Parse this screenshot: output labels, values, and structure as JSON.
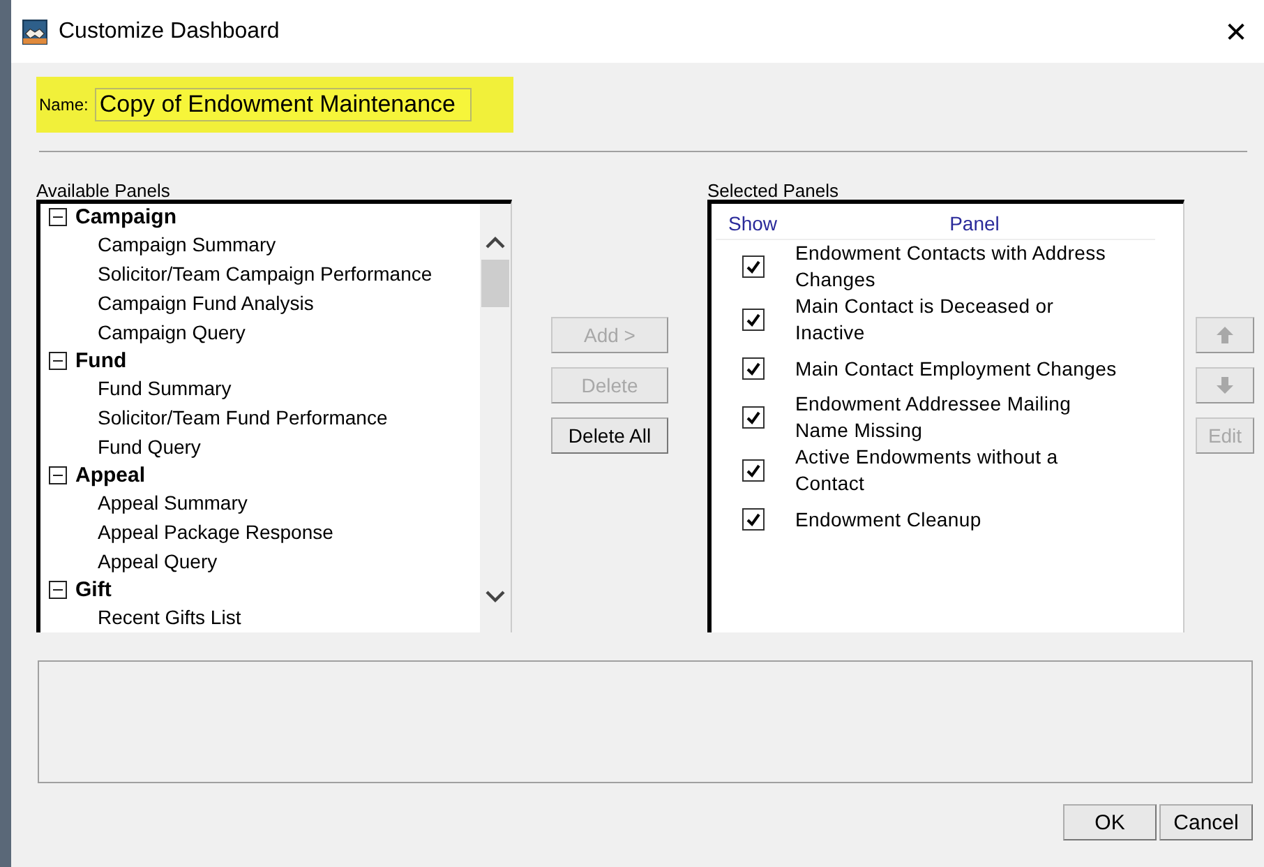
{
  "window": {
    "title": "Customize Dashboard",
    "close": "✕"
  },
  "name_field": {
    "label": "Name:",
    "value": "Copy of Endowment Maintenance",
    "highlighted": true
  },
  "available_panels": {
    "label": "Available Panels",
    "groups": [
      {
        "label": "Campaign",
        "expanded": true,
        "children": [
          {
            "label": "Campaign Summary"
          },
          {
            "label": "Solicitor/Team Campaign Performance"
          },
          {
            "label": "Campaign Fund Analysis"
          },
          {
            "label": "Campaign Query"
          }
        ]
      },
      {
        "label": "Fund",
        "expanded": true,
        "children": [
          {
            "label": "Fund Summary"
          },
          {
            "label": "Solicitor/Team Fund Performance"
          },
          {
            "label": "Fund Query"
          }
        ]
      },
      {
        "label": "Appeal",
        "expanded": true,
        "children": [
          {
            "label": "Appeal Summary"
          },
          {
            "label": "Appeal Package Response"
          },
          {
            "label": "Appeal Query"
          }
        ]
      },
      {
        "label": "Gift",
        "expanded": true,
        "children": [
          {
            "label": "Recent Gifts List"
          }
        ]
      }
    ]
  },
  "middle_buttons": [
    {
      "label": "Add >",
      "disabled": true
    },
    {
      "label": "Delete",
      "disabled": true
    },
    {
      "label": "Delete All",
      "disabled": false
    }
  ],
  "selected_panels": {
    "label": "Selected Panels",
    "columns": [
      "Show",
      "Panel"
    ],
    "rows": [
      {
        "panel": "Endowment Contacts with Address Changes",
        "checked": true
      },
      {
        "panel": "Main Contact is Deceased or Inactive",
        "checked": true
      },
      {
        "panel": "Main Contact Employment Changes",
        "checked": true
      },
      {
        "panel": "Endowment Addressee Mailing Name Missing",
        "checked": true
      },
      {
        "panel": "Active Endowments without a Contact",
        "checked": true
      },
      {
        "panel": "Endowment Cleanup",
        "checked": true
      }
    ]
  },
  "side_buttons": [
    {
      "kind": "up",
      "disabled": true
    },
    {
      "kind": "down",
      "disabled": true
    },
    {
      "kind": "text",
      "label": "Edit",
      "disabled": true
    }
  ],
  "footer_buttons": [
    {
      "label": "OK"
    },
    {
      "label": "Cancel"
    }
  ]
}
